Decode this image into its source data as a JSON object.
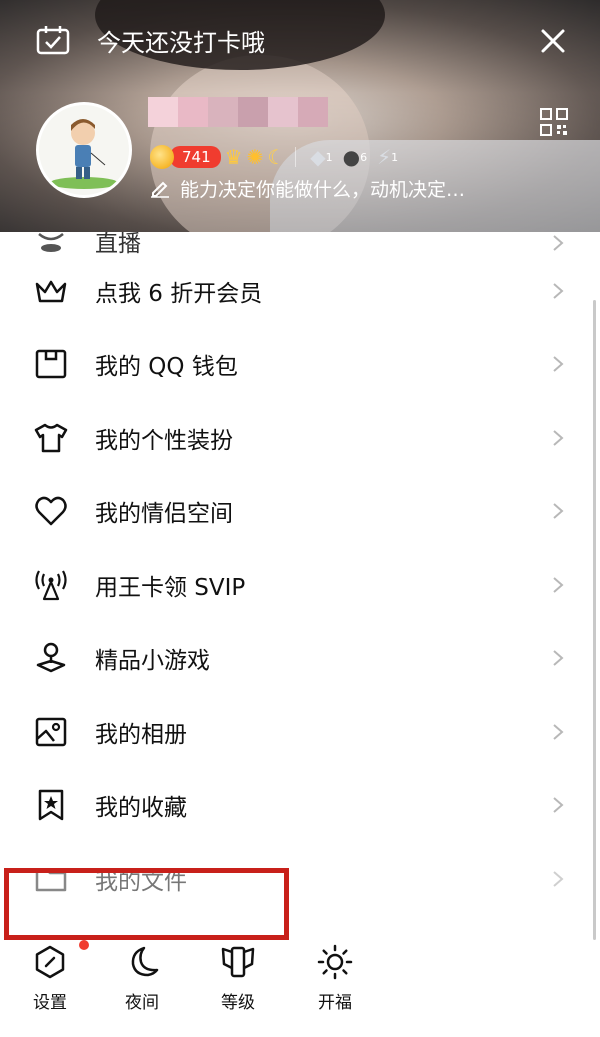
{
  "header": {
    "checkin_text": "今天还没打卡哦",
    "level_number": "741",
    "signature": "能力决定你能做什么，动机决定…",
    "badge_counts": [
      "1",
      "6",
      "1"
    ]
  },
  "menu": {
    "items": [
      {
        "label": "直播",
        "icon": "live-icon"
      },
      {
        "label": "点我 6 折开会员",
        "icon": "crown-icon"
      },
      {
        "label": "我的 QQ 钱包",
        "icon": "wallet-icon"
      },
      {
        "label": "我的个性装扮",
        "icon": "tshirt-icon"
      },
      {
        "label": "我的情侣空间",
        "icon": "heart-icon"
      },
      {
        "label": "用王卡领 SVIP",
        "icon": "antenna-icon"
      },
      {
        "label": "精品小游戏",
        "icon": "joystick-icon"
      },
      {
        "label": "我的相册",
        "icon": "photo-album-icon"
      },
      {
        "label": "我的收藏",
        "icon": "bookmark-icon"
      },
      {
        "label": "我的文件",
        "icon": "folder-icon"
      }
    ]
  },
  "toolbar": {
    "settings": "设置",
    "night": "夜间",
    "level": "等级",
    "blessing": "开福"
  },
  "colors": {
    "highlight_border": "#c8201a",
    "level_pill": "#f03c2f",
    "notification_dot": "#f03c2f"
  }
}
